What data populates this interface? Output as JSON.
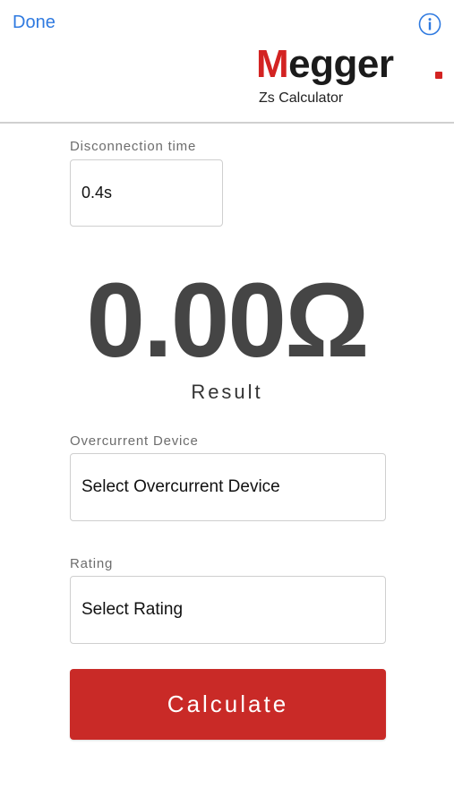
{
  "header": {
    "done_label": "Done",
    "brand_first": "M",
    "brand_rest": "egger",
    "subtitle": "Zs Calculator",
    "accent_color": "#2f7ae0",
    "brand_color": "#d32322"
  },
  "disconnection": {
    "label": "Disconnection time",
    "value": "0.4s"
  },
  "result": {
    "value": "0.00Ω",
    "label": "Result"
  },
  "overcurrent": {
    "label": "Overcurrent Device",
    "value": "Select Overcurrent Device"
  },
  "rating": {
    "label": "Rating",
    "value": "Select Rating"
  },
  "actions": {
    "calculate_label": "Calculate",
    "calculate_color": "#c92a27"
  },
  "icons": {
    "info": "info-icon"
  }
}
